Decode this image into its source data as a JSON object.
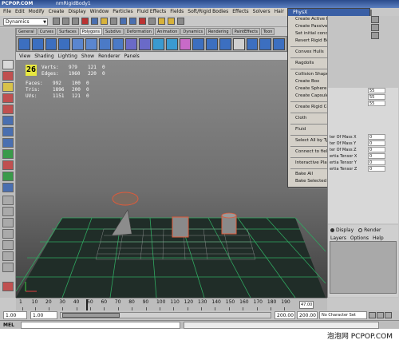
{
  "title_bar": {
    "watermark": "PCPOP.COM",
    "title": "nmRigidBody1"
  },
  "menubar": [
    "File",
    "Edit",
    "Modify",
    "Create",
    "Display",
    "Window",
    "Particles",
    "Fluid Effects",
    "Fields",
    "Soft/Rigid Bodies",
    "Effects",
    "Solvers",
    "Hair"
  ],
  "status_line": {
    "mode": "Dynamics"
  },
  "shelf_tabs": [
    "General",
    "Curves",
    "Surfaces",
    "Polygons",
    "Subdivs",
    "Deformation",
    "Animation",
    "Dynamics",
    "Rendering",
    "PaintEffects",
    "Toon"
  ],
  "active_shelf": "Polygons",
  "panel_menu": [
    "View",
    "Shading",
    "Lighting",
    "Show",
    "Renderer",
    "Panels"
  ],
  "hud": {
    "fps": "26",
    "rows": [
      {
        "label": "Verts:",
        "v1": "979",
        "v2": "121",
        "v3": "0"
      },
      {
        "label": "Edges:",
        "v1": "1960",
        "v2": "220",
        "v3": "0"
      },
      {
        "label": "Faces:",
        "v1": "992",
        "v2": "100",
        "v3": "0"
      },
      {
        "label": "Tris:",
        "v1": "1896",
        "v2": "200",
        "v3": "0"
      },
      {
        "label": "UVs:",
        "v1": "1151",
        "v2": "121",
        "v3": "0"
      }
    ]
  },
  "physx_menu": {
    "title": "PhysX",
    "groups": [
      [
        {
          "label": "Create Active Rigid Body",
          "options": true
        },
        {
          "label": "Create Passive Rigid Body",
          "options": true
        },
        {
          "label": "Set initial conditions"
        },
        {
          "label": "Revert Rigid Body"
        }
      ],
      [
        {
          "label": "Convex Hulls",
          "submenu": true
        }
      ],
      [
        {
          "label": "Ragdolls",
          "submenu": true
        }
      ],
      [
        {
          "label": "Collision Shapes",
          "submenu": true
        },
        {
          "label": "Create Box"
        },
        {
          "label": "Create Sphere"
        },
        {
          "label": "Create Capsule"
        }
      ],
      [
        {
          "label": "Create Rigid Constraint",
          "options": true
        }
      ],
      [
        {
          "label": "Cloth",
          "submenu": true
        }
      ],
      [
        {
          "label": "Fluid",
          "submenu": true
        }
      ],
      [
        {
          "label": "Select All by Type",
          "submenu": true
        }
      ],
      [
        {
          "label": "Connect to fields"
        }
      ],
      [
        {
          "label": "Interactive Playback"
        }
      ],
      [
        {
          "label": "Bake All"
        },
        {
          "label": "Bake Selected"
        }
      ]
    ]
  },
  "channel_box": {
    "rows": [
      {
        "label": "",
        "value": "55"
      },
      {
        "label": "",
        "value": "55"
      },
      {
        "label": "",
        "value": "55"
      },
      {
        "label": "ter Of Mass X",
        "value": "0"
      },
      {
        "label": "ter Of Mass Y",
        "value": "0"
      },
      {
        "label": "ter Of Mass Z",
        "value": "0"
      },
      {
        "label": "ertia Tensor X",
        "value": "0"
      },
      {
        "label": "ertia Tensor Y",
        "value": "0"
      },
      {
        "label": "ertia Tensor Z",
        "value": "0"
      }
    ]
  },
  "layer_editor": {
    "display_label": "Display",
    "render_label": "Render",
    "menu": [
      "Layers",
      "Options",
      "Help"
    ]
  },
  "timeline": {
    "ticks": [
      "1",
      "10",
      "20",
      "30",
      "40",
      "50",
      "60",
      "70",
      "80",
      "90",
      "100",
      "110",
      "120",
      "130",
      "140",
      "150",
      "160",
      "170",
      "180",
      "190"
    ],
    "current_frame": "47.00"
  },
  "range": {
    "start_a": "1.00",
    "start_b": "1.00",
    "end_a": "200.00",
    "end_b": "200.00",
    "character": "No Character Set"
  },
  "command_line": {
    "label": "MEL"
  },
  "footer": {
    "watermark": "泡泡网 PCPOP.COM"
  }
}
